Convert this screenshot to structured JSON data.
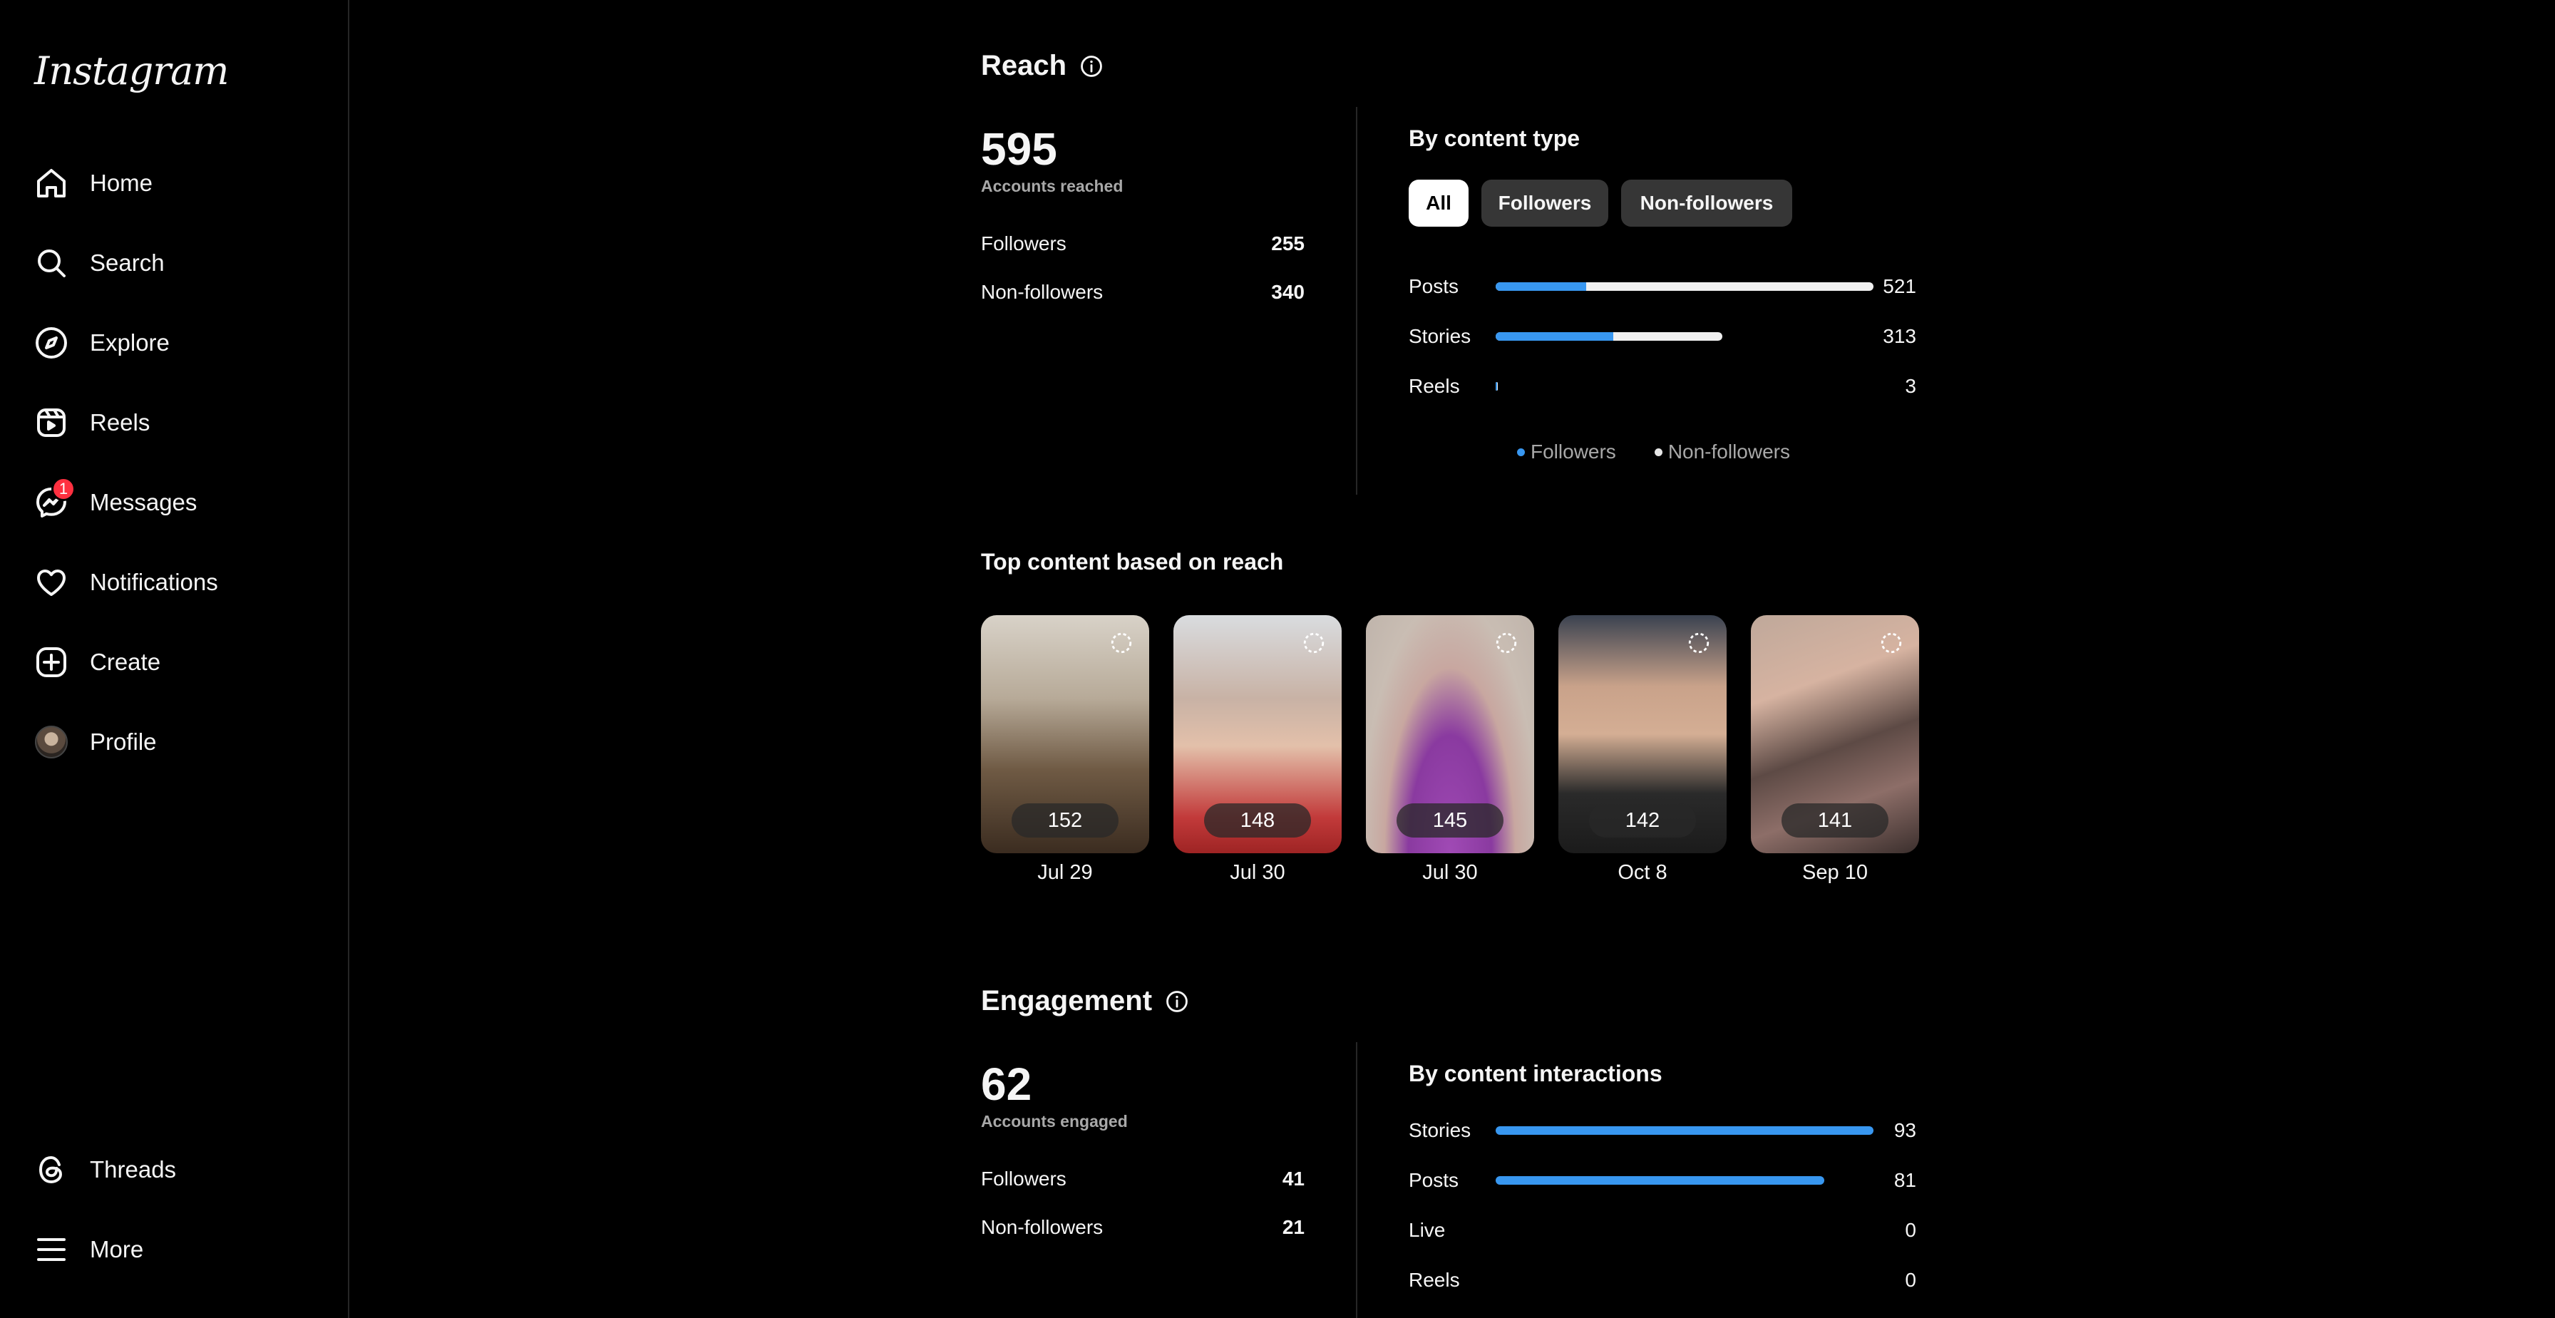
{
  "app": {
    "logo": "Instagram"
  },
  "nav": {
    "items": [
      {
        "label": "Home",
        "icon": "home-icon"
      },
      {
        "label": "Search",
        "icon": "search-icon"
      },
      {
        "label": "Explore",
        "icon": "compass-icon"
      },
      {
        "label": "Reels",
        "icon": "reels-icon"
      },
      {
        "label": "Messages",
        "icon": "messenger-icon",
        "badge": "1"
      },
      {
        "label": "Notifications",
        "icon": "heart-icon"
      },
      {
        "label": "Create",
        "icon": "plus-square-icon"
      },
      {
        "label": "Profile",
        "icon": "avatar-icon"
      }
    ],
    "bottom": [
      {
        "label": "Threads",
        "icon": "threads-icon"
      },
      {
        "label": "More",
        "icon": "menu-icon"
      }
    ]
  },
  "reach": {
    "title": "Reach",
    "total": "595",
    "total_label": "Accounts reached",
    "followers_label": "Followers",
    "followers_value": "255",
    "nonfollowers_label": "Non-followers",
    "nonfollowers_value": "340",
    "by_type_title": "By content type",
    "filters": [
      "All",
      "Followers",
      "Non-followers"
    ],
    "active_filter": "All",
    "rows": [
      {
        "name": "Posts",
        "value": "521",
        "followers_frac": 0.24,
        "total_frac": 1.0
      },
      {
        "name": "Stories",
        "value": "313",
        "followers_frac": 0.52,
        "total_frac": 0.6
      },
      {
        "name": "Reels",
        "value": "3",
        "followers_frac": 0.006,
        "total_frac": 0.006
      }
    ],
    "legend": [
      "Followers",
      "Non-followers"
    ],
    "colors": {
      "followers": "#3897f0",
      "nonfollowers": "#f0f0f0"
    }
  },
  "top_content": {
    "title": "Top content based on reach",
    "items": [
      {
        "count": "152",
        "date": "Jul 29"
      },
      {
        "count": "148",
        "date": "Jul 30"
      },
      {
        "count": "145",
        "date": "Jul 30"
      },
      {
        "count": "142",
        "date": "Oct 8"
      },
      {
        "count": "141",
        "date": "Sep 10"
      }
    ]
  },
  "engagement": {
    "title": "Engagement",
    "total": "62",
    "total_label": "Accounts engaged",
    "followers_label": "Followers",
    "followers_value": "41",
    "nonfollowers_label": "Non-followers",
    "nonfollowers_value": "21",
    "by_interactions_title": "By content interactions",
    "rows": [
      {
        "name": "Stories",
        "value": "93",
        "frac": 1.0
      },
      {
        "name": "Posts",
        "value": "81",
        "frac": 0.87
      },
      {
        "name": "Live",
        "value": "0",
        "frac": 0
      },
      {
        "name": "Reels",
        "value": "0",
        "frac": 0
      }
    ]
  }
}
